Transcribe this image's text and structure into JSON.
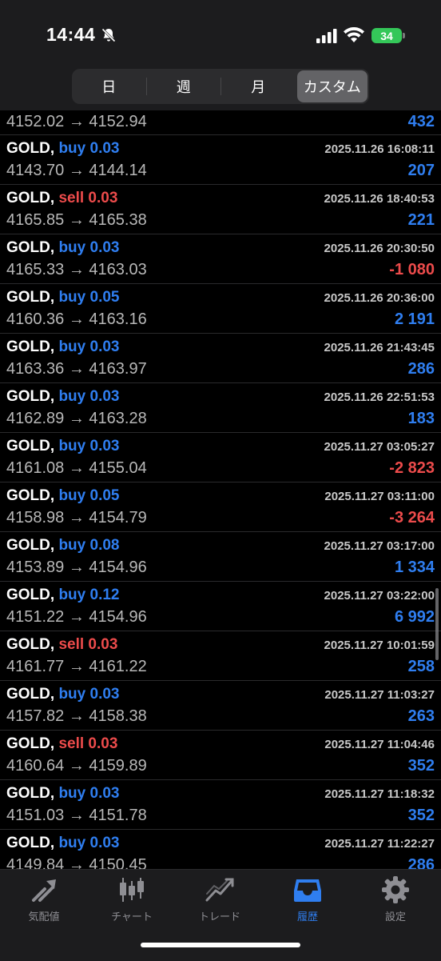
{
  "status": {
    "time": "14:44",
    "battery": "34"
  },
  "segments": [
    {
      "label": "日",
      "active": false
    },
    {
      "label": "週",
      "active": false
    },
    {
      "label": "月",
      "active": false
    },
    {
      "label": "カスタム",
      "active": true
    }
  ],
  "first_row": {
    "prices": "4152.02 → 4152.94",
    "profit": "432"
  },
  "rows": [
    {
      "symbol": "GOLD,",
      "side": "buy 0.03",
      "datetime": "2025.11.26 16:08:11",
      "prices": "4143.70 → 4144.14",
      "profit": "207"
    },
    {
      "symbol": "GOLD,",
      "side": "sell 0.03",
      "datetime": "2025.11.26 18:40:53",
      "prices": "4165.85 → 4165.38",
      "profit": "221"
    },
    {
      "symbol": "GOLD,",
      "side": "buy 0.03",
      "datetime": "2025.11.26 20:30:50",
      "prices": "4165.33 → 4163.03",
      "profit": "-1 080"
    },
    {
      "symbol": "GOLD,",
      "side": "buy 0.05",
      "datetime": "2025.11.26 20:36:00",
      "prices": "4160.36 → 4163.16",
      "profit": "2 191"
    },
    {
      "symbol": "GOLD,",
      "side": "buy 0.03",
      "datetime": "2025.11.26 21:43:45",
      "prices": "4163.36 → 4163.97",
      "profit": "286"
    },
    {
      "symbol": "GOLD,",
      "side": "buy 0.03",
      "datetime": "2025.11.26 22:51:53",
      "prices": "4162.89 → 4163.28",
      "profit": "183"
    },
    {
      "symbol": "GOLD,",
      "side": "buy 0.03",
      "datetime": "2025.11.27 03:05:27",
      "prices": "4161.08 → 4155.04",
      "profit": "-2 823"
    },
    {
      "symbol": "GOLD,",
      "side": "buy 0.05",
      "datetime": "2025.11.27 03:11:00",
      "prices": "4158.98 → 4154.79",
      "profit": "-3 264"
    },
    {
      "symbol": "GOLD,",
      "side": "buy 0.08",
      "datetime": "2025.11.27 03:17:00",
      "prices": "4153.89 → 4154.96",
      "profit": "1 334"
    },
    {
      "symbol": "GOLD,",
      "side": "buy 0.12",
      "datetime": "2025.11.27 03:22:00",
      "prices": "4151.22 → 4154.96",
      "profit": "6 992"
    },
    {
      "symbol": "GOLD,",
      "side": "sell 0.03",
      "datetime": "2025.11.27 10:01:59",
      "prices": "4161.77 → 4161.22",
      "profit": "258"
    },
    {
      "symbol": "GOLD,",
      "side": "buy 0.03",
      "datetime": "2025.11.27 11:03:27",
      "prices": "4157.82 → 4158.38",
      "profit": "263"
    },
    {
      "symbol": "GOLD,",
      "side": "sell 0.03",
      "datetime": "2025.11.27 11:04:46",
      "prices": "4160.64 → 4159.89",
      "profit": "352"
    },
    {
      "symbol": "GOLD,",
      "side": "buy 0.03",
      "datetime": "2025.11.27 11:18:32",
      "prices": "4151.03 → 4151.78",
      "profit": "352"
    },
    {
      "symbol": "GOLD,",
      "side": "buy 0.03",
      "datetime": "2025.11.27 11:22:27",
      "prices": "4149.84 → 4150.45",
      "profit": "286"
    }
  ],
  "tabs": [
    {
      "label": "気配値",
      "icon": "quotes-arrows-icon",
      "active": false
    },
    {
      "label": "チャート",
      "icon": "candlestick-chart-icon",
      "active": false
    },
    {
      "label": "トレード",
      "icon": "trade-trend-icon",
      "active": false
    },
    {
      "label": "履歴",
      "icon": "history-inbox-icon",
      "active": true
    },
    {
      "label": "設定",
      "icon": "settings-gear-icon",
      "active": false
    }
  ],
  "colors": {
    "buy": "#2f7ef0",
    "sell": "#ec4b4b",
    "active_tab": "#2f7ef0",
    "inactive_tab": "#8e8e93"
  }
}
